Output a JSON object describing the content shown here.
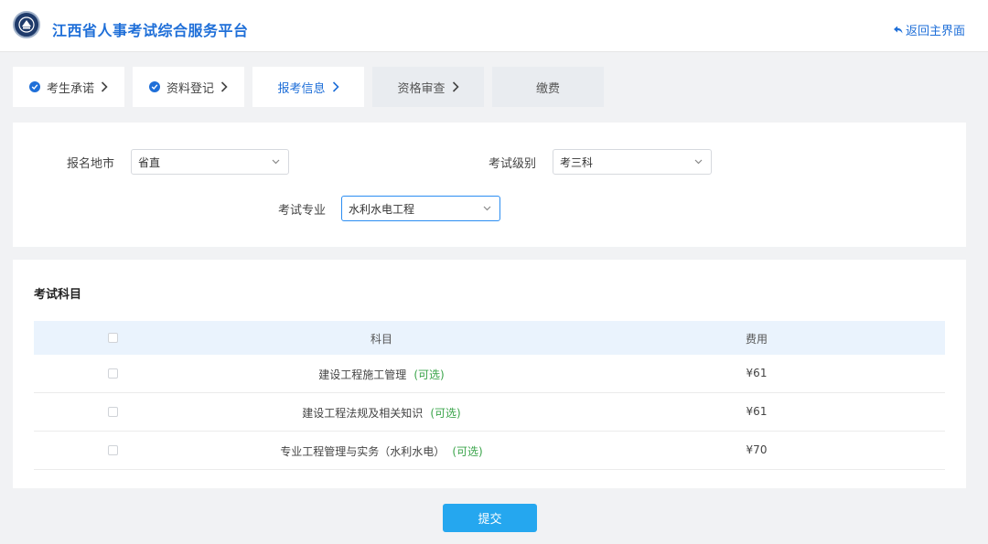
{
  "header": {
    "title": "江西省人事考试综合服务平台",
    "back_label": "返回主界面",
    "logo_icon": "emblem-icon",
    "accent_color": "#1f6fd8"
  },
  "steps": [
    {
      "label": "考生承诺",
      "completed": true
    },
    {
      "label": "资料登记",
      "completed": true
    },
    {
      "label": "报考信息",
      "active": true
    },
    {
      "label": "资格审查"
    },
    {
      "label": "缴费"
    }
  ],
  "form": {
    "city_label": "报名地市",
    "city_value": "省直",
    "level_label": "考试级别",
    "level_value": "考三科",
    "major_label": "考试专业",
    "major_value": "水利水电工程"
  },
  "subjects": {
    "title": "考试科目",
    "headers": {
      "subject": "科目",
      "fee": "费用"
    },
    "optional_label": "(可选)",
    "rows": [
      {
        "subject": "建设工程施工管理",
        "fee": "¥61"
      },
      {
        "subject": "建设工程法规及相关知识",
        "fee": "¥61"
      },
      {
        "subject": "专业工程管理与实务（水利水电）",
        "fee": "¥70"
      }
    ]
  },
  "submit_label": "提交",
  "colors": {
    "primary": "#1f6fd8",
    "button": "#25a7ef",
    "optional": "#3aa44a",
    "table_header": "#eaf3fd"
  }
}
